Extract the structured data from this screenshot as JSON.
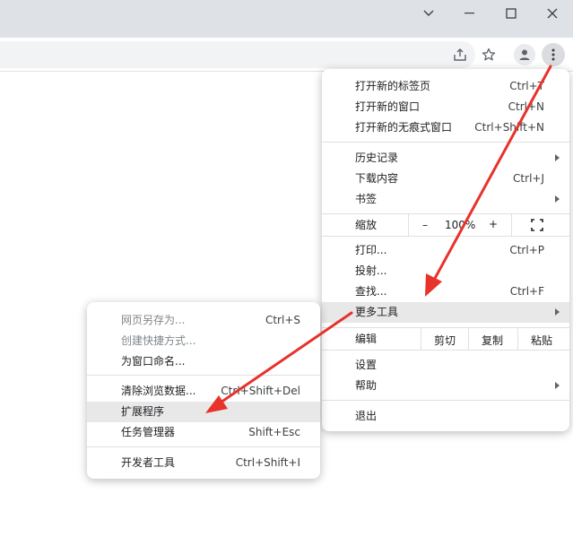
{
  "main_menu": {
    "new_tab": {
      "label": "打开新的标签页",
      "shortcut": "Ctrl+T"
    },
    "new_window": {
      "label": "打开新的窗口",
      "shortcut": "Ctrl+N"
    },
    "new_incognito": {
      "label": "打开新的无痕式窗口",
      "shortcut": "Ctrl+Shift+N"
    },
    "history": {
      "label": "历史记录"
    },
    "downloads": {
      "label": "下载内容",
      "shortcut": "Ctrl+J"
    },
    "bookmarks": {
      "label": "书签"
    },
    "zoom": {
      "label": "缩放",
      "minus": "–",
      "value": "100%",
      "plus": "+"
    },
    "print": {
      "label": "打印...",
      "shortcut": "Ctrl+P"
    },
    "cast": {
      "label": "投射..."
    },
    "find": {
      "label": "查找...",
      "shortcut": "Ctrl+F"
    },
    "more_tools": {
      "label": "更多工具"
    },
    "edit": {
      "label": "编辑",
      "cut": "剪切",
      "copy": "复制",
      "paste": "粘贴"
    },
    "settings": {
      "label": "设置"
    },
    "help": {
      "label": "帮助"
    },
    "exit": {
      "label": "退出"
    }
  },
  "submenu": {
    "save_page": {
      "label": "网页另存为...",
      "shortcut": "Ctrl+S"
    },
    "create_shortcut": {
      "label": "创建快捷方式..."
    },
    "name_window": {
      "label": "为窗口命名..."
    },
    "clear_data": {
      "label": "清除浏览数据...",
      "shortcut": "Ctrl+Shift+Del"
    },
    "extensions": {
      "label": "扩展程序"
    },
    "task_manager": {
      "label": "任务管理器",
      "shortcut": "Shift+Esc"
    },
    "devtools": {
      "label": "开发者工具",
      "shortcut": "Ctrl+Shift+I"
    }
  },
  "colors": {
    "annotation_arrow": "#e8322b",
    "highlight": "#e8e8e9"
  },
  "icons": [
    "chevron-down-icon",
    "minimize-icon",
    "maximize-icon",
    "close-icon",
    "share-icon",
    "star-icon",
    "profile-icon",
    "kebab-menu-icon",
    "fullscreen-icon"
  ]
}
